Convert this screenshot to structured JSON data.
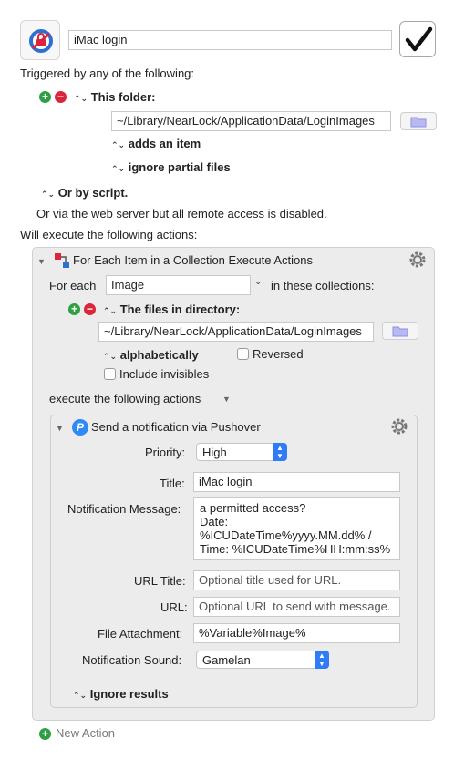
{
  "macro": {
    "name": "iMac login",
    "enabled_check": "✓"
  },
  "triggers": {
    "heading": "Triggered by any of the following:",
    "folder_label": "This folder:",
    "folder_path": "~/Library/NearLock/ApplicationData/LoginImages",
    "adds_option": "adds an item",
    "ignore_option": "ignore partial files",
    "or_by_script": "Or by script.",
    "web_server_note": "Or via the web server but all remote access is disabled."
  },
  "actions": {
    "heading": "Will execute the following actions:",
    "for_each": {
      "title": "For Each Item in a Collection Execute Actions",
      "for_each_label": "For each",
      "variable": "Image",
      "collections_label": "in these collections:",
      "collection_type": "The files in directory:",
      "directory": "~/Library/NearLock/ApplicationData/LoginImages",
      "sort": "alphabetically",
      "reversed_label": "Reversed",
      "include_invisibles_label": "Include invisibles",
      "execute_label": "execute the following actions"
    },
    "pushover": {
      "title": "Send a notification via Pushover",
      "priority_label": "Priority:",
      "priority_value": "High",
      "title_label": "Title:",
      "title_value": "iMac login",
      "message_label": "Notification Message:",
      "message_line1": "a permitted access?",
      "message_line2": "Date:",
      "message_line3": "%ICUDateTime%yyyy.MM.dd% /",
      "message_line4": "Time: %ICUDateTime%HH:mm:ss%",
      "url_title_label": "URL Title:",
      "url_title_placeholder": "Optional title used for URL.",
      "url_label": "URL:",
      "url_placeholder": "Optional URL to send with message.",
      "attachment_label": "File Attachment:",
      "attachment_value": "%Variable%Image%",
      "sound_label": "Notification Sound:",
      "sound_value": "Gamelan",
      "ignore_results": "Ignore results"
    },
    "new_action": "New Action"
  },
  "colors": {
    "accent": "#2f7cf6",
    "add": "#2ea043",
    "remove": "#d9263b"
  }
}
